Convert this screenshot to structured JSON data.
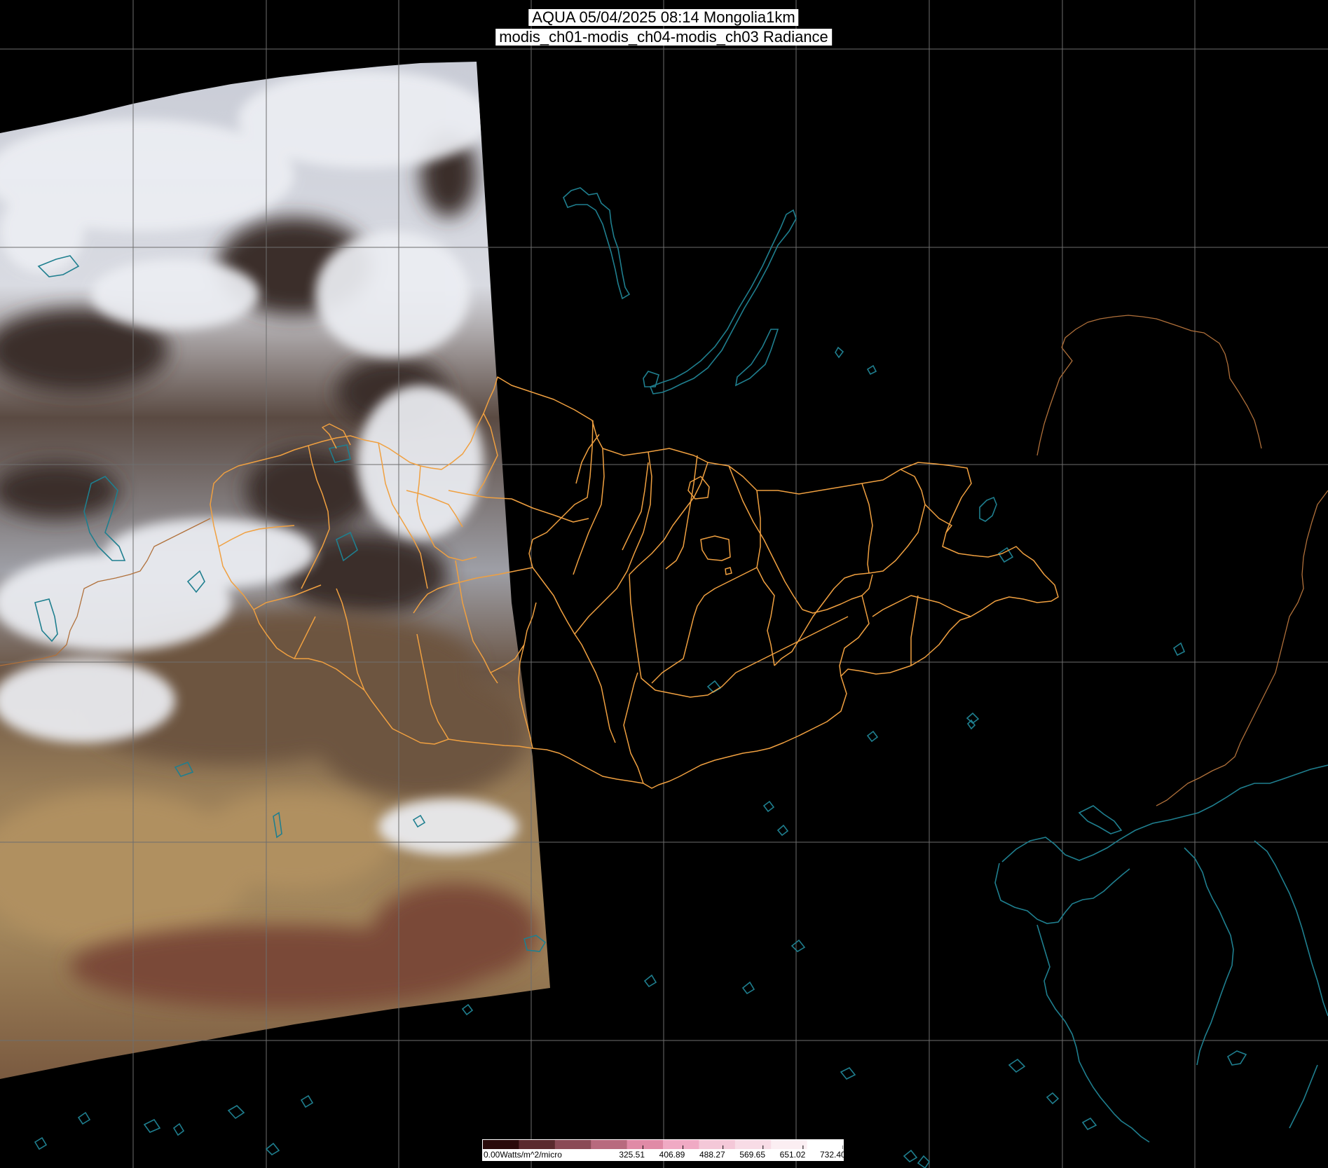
{
  "header": {
    "title_line1": "AQUA 05/04/2025 08:14 Mongolia1km",
    "title_line2": "modis_ch01-modis_ch04-modis_ch03 Radiance"
  },
  "colors": {
    "background": "#000000",
    "grid": "#6e6e6e",
    "coastline": "#1f7f8f",
    "admin_border": "#f0a040",
    "country_border": "#b0703a",
    "cloud": "#e6e8ee",
    "desert": "#a88a5c",
    "terrain": "#4a3a2e"
  },
  "colorbar": {
    "unit_label": "0.00Watts/m^2/micro",
    "ticks": [
      "325.51",
      "406.89",
      "488.27",
      "569.65",
      "651.02",
      "732.40"
    ],
    "min": 0.0,
    "max": 732.4,
    "colors": [
      "#2a0a0a",
      "#5a2a2e",
      "#8a4a56",
      "#b86a7e",
      "#e08aa6",
      "#f0aac4",
      "#f4c8d8",
      "#f8dce6",
      "#fbeef2",
      "#ffffff"
    ]
  },
  "map_layers": {
    "graticule": "lat-lon-grid",
    "swath": "satellite-swath",
    "borders": "mongolia-province-borders",
    "coastlines": "lakes-and-coastlines"
  }
}
